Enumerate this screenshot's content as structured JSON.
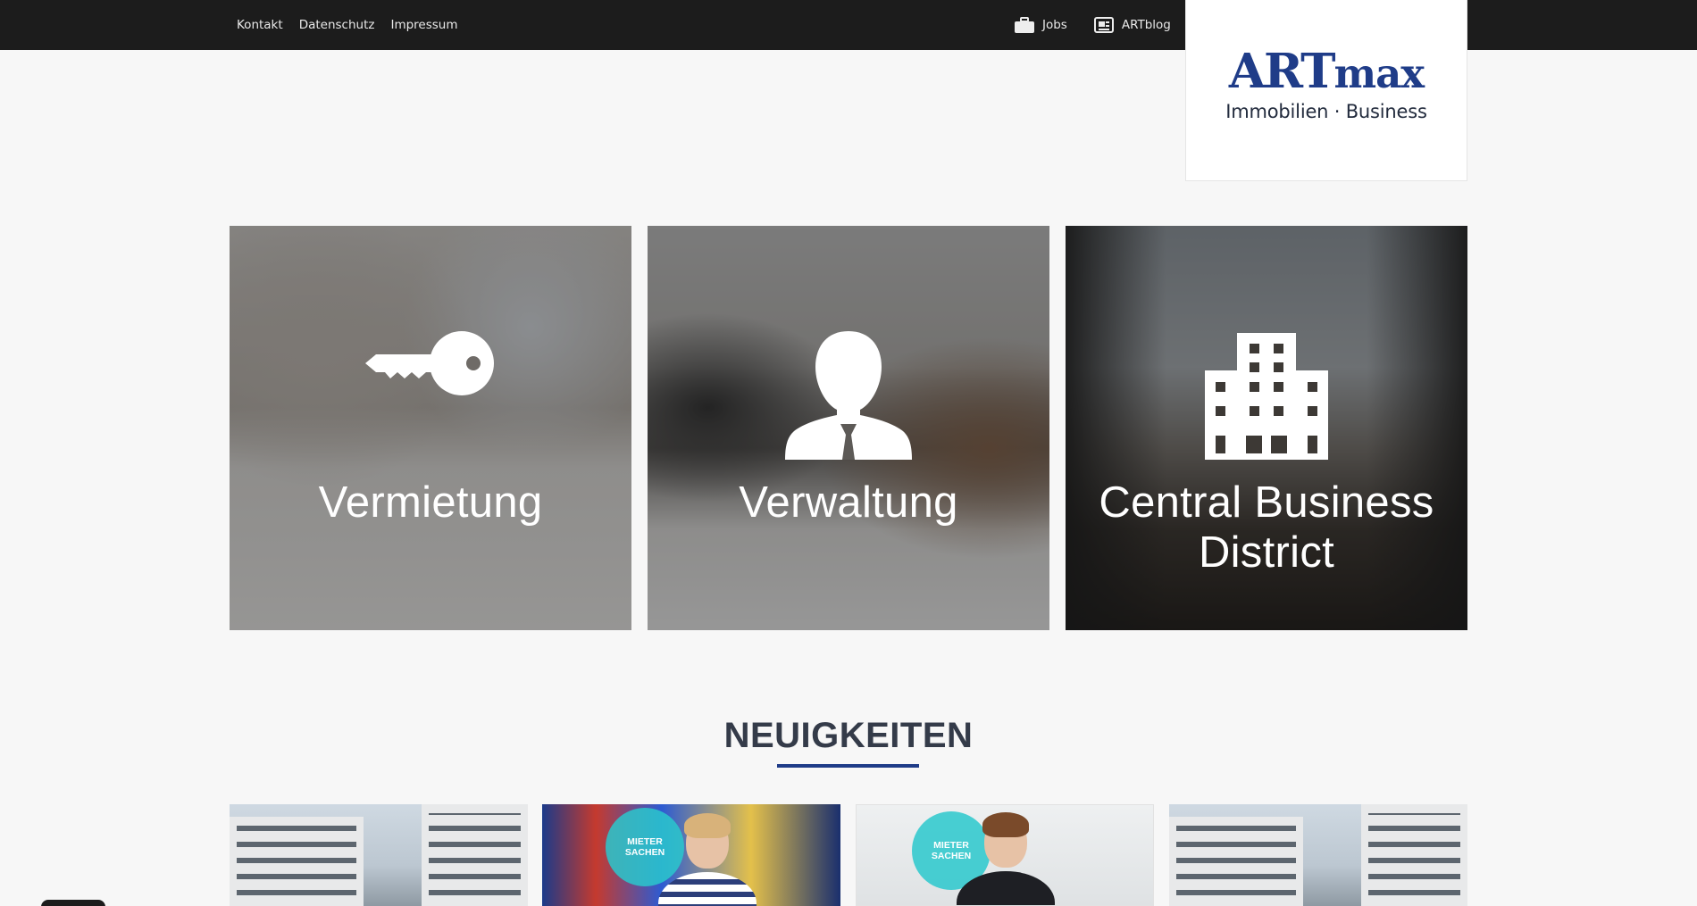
{
  "topbar": {
    "left_links": [
      "Kontakt",
      "Datenschutz",
      "Impressum"
    ],
    "right_links": [
      {
        "label": "Jobs",
        "icon": "briefcase-icon"
      },
      {
        "label": "ARTblog",
        "icon": "newspaper-icon"
      }
    ],
    "background": "#1c1c1c"
  },
  "logo": {
    "main_art": "ART",
    "main_max": "max",
    "subtitle": "Immobilien · Business",
    "color": "#1f3c88"
  },
  "services": [
    {
      "label": "Vermietung",
      "icon": "key-icon"
    },
    {
      "label": "Verwaltung",
      "icon": "businessman-icon"
    },
    {
      "label": "Central Business District",
      "icon": "building-icon"
    }
  ],
  "news_section": {
    "title": "NEUIGKEITEN",
    "underline_color": "#1f3c88",
    "cards": [
      {
        "image": "building-street-photo"
      },
      {
        "image": "mieter-sachen-woman-photo",
        "badge": [
          "MIETER",
          "SACHEN"
        ]
      },
      {
        "image": "mieter-sachen-man-photo",
        "badge": [
          "MIETER",
          "SACHEN"
        ]
      },
      {
        "image": "building-street-photo"
      }
    ]
  }
}
